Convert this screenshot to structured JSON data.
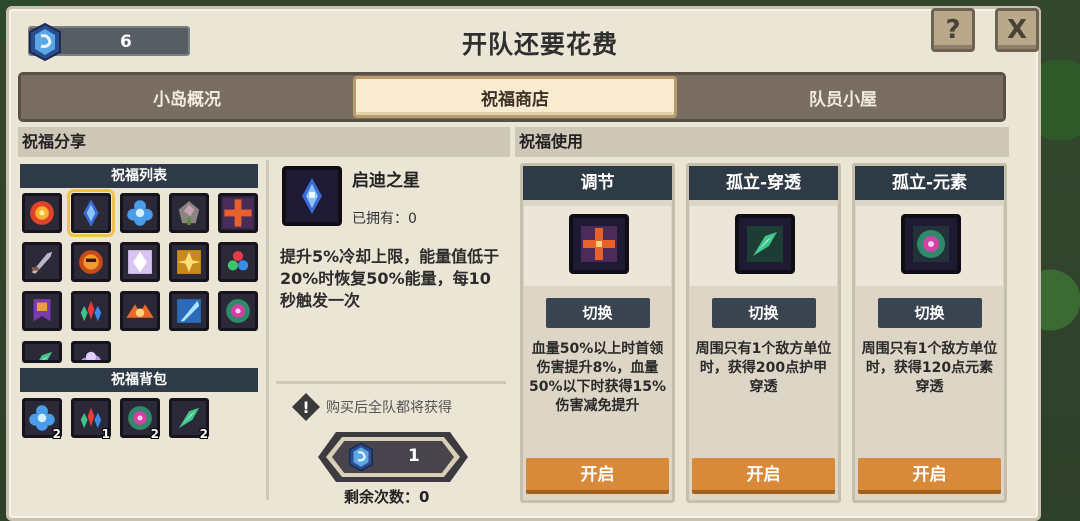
{
  "currency": {
    "count": "6",
    "icon": "blue-gem-icon"
  },
  "title": "开队还要花费",
  "buttons": {
    "help": "?",
    "close": "X"
  },
  "tabs": [
    {
      "label": "小岛概况",
      "active": false
    },
    {
      "label": "祝福商店",
      "active": true
    },
    {
      "label": "队员小屋",
      "active": false
    }
  ],
  "share": {
    "header": "祝福分享",
    "list_header": "祝福列表",
    "list_items": [
      "fire-burst-icon",
      "blue-star-icon",
      "blue-flower-icon",
      "stone-gem-icon",
      "orange-cross-icon",
      "sword-icon",
      "orange-sun-icon",
      "light-crystal-icon",
      "gold-sparkle-icon",
      "tri-orb-icon",
      "purple-banner-icon",
      "tri-flame-icon",
      "flame-wings-icon",
      "ice-shard-icon",
      "green-core-icon",
      "green-leaf-icon",
      "purple-cloud-icon"
    ],
    "bag_header": "祝福背包",
    "bag_items": [
      {
        "icon": "blue-flower-icon",
        "count": "2"
      },
      {
        "icon": "tri-flame-icon",
        "count": "1"
      },
      {
        "icon": "green-core-icon",
        "count": "2"
      },
      {
        "icon": "green-leaf-icon",
        "count": "2"
      }
    ]
  },
  "detail": {
    "name": "启迪之星",
    "owned": "已拥有：0",
    "description": "提升5%冷却上限，能量值低于20%时恢复50%能量，每10秒触发一次",
    "buy_note": "购买后全队都将获得",
    "price": "1",
    "remaining": "剩余次数：0"
  },
  "usage": {
    "header": "祝福使用",
    "cards": [
      {
        "title": "调节",
        "icon": "orange-cross-icon",
        "switch": "切换",
        "desc": "血量50%以上时首领伤害提升8%，血量50%以下时获得15%伤害减免提升",
        "open": "开启"
      },
      {
        "title": "孤立-穿透",
        "icon": "green-leaf-icon",
        "switch": "切换",
        "desc": "周围只有1个敌方单位时，获得200点护甲穿透",
        "open": "开启"
      },
      {
        "title": "孤立-元素",
        "icon": "green-core-icon",
        "switch": "切换",
        "desc": "周围只有1个敌方单位时，获得120点元素穿透",
        "open": "开启"
      }
    ]
  },
  "colors": {
    "accent_orange": "#d88a3a",
    "dark_header": "#2f3a47",
    "panel": "#ebe5d6"
  }
}
